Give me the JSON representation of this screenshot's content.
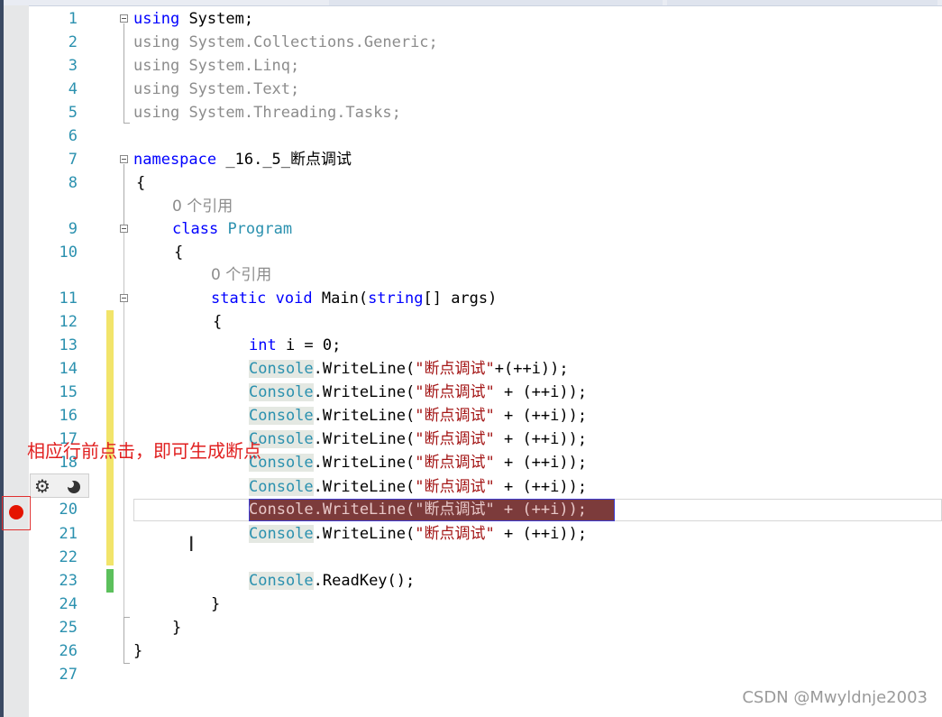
{
  "editor": {
    "line_numbers": [
      "1",
      "2",
      "3",
      "4",
      "5",
      "6",
      "7",
      "8",
      "9",
      "10",
      "11",
      "12",
      "13",
      "14",
      "15",
      "16",
      "17",
      "18",
      "20",
      "21",
      "22",
      "23",
      "24",
      "25",
      "26",
      "27"
    ],
    "using": {
      "kw": "using",
      "l1": "System;",
      "l2": "System.Collections.Generic;",
      "l3": "System.Linq;",
      "l4": "System.Text;",
      "l5": "System.Threading.Tasks;"
    },
    "namespace_kw": "namespace",
    "namespace_name": "_16._5_断点调试",
    "open_brace": "{",
    "close_brace": "}",
    "ref_count": "0 个引用",
    "class_kw": "class",
    "class_name": "Program",
    "main_sig": {
      "static": "static",
      "void": "void",
      "name": "Main(",
      "string": "string",
      "rest": "[] args)"
    },
    "int_kw": "int",
    "int_rest": " i = 0;",
    "console": "Console",
    "writeline_open": ".WriteLine(",
    "str_literal": "\"断点调试\"",
    "first_tail": "+(++i));",
    "tail": " + (++i));",
    "readkey": ".ReadKey();",
    "bp_line_text": "Console.WriteLine(\"断点调试\" + (++i));"
  },
  "annotation": "相应行前点击，即可生成断点",
  "watermark": "CSDN @Mwyldnje2003",
  "icons": {
    "gear": "⚙"
  }
}
